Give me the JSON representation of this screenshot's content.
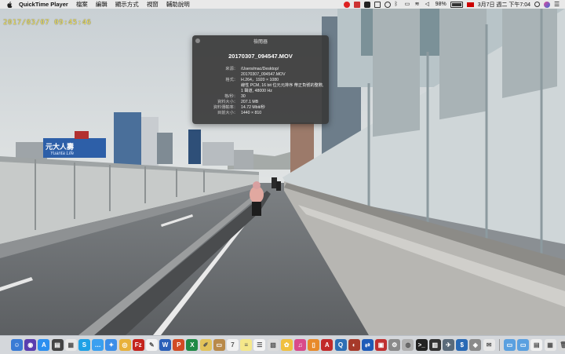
{
  "menubar": {
    "app_name": "QuickTime Player",
    "items": [
      "檔案",
      "編輯",
      "顯示方式",
      "視窗",
      "輔助說明"
    ],
    "battery_percent": "98%",
    "datetime": "3月7日 週二 下午7:04"
  },
  "video": {
    "timestamp": "2017/03/07  09:45:46",
    "billboard_text": "元大人壽",
    "billboard_sub": "Yuanta Life"
  },
  "inspector": {
    "title": "檢閱器",
    "filename": "20170307_094547.MOV",
    "rows": [
      {
        "key": "來源：",
        "value": "/Users/mac/Desktop/\n20170307_094547.MOV"
      },
      {
        "key": "格式：",
        "value": "H.264，1920 × 1080\n線性 PCM, 16 bit 位元元排序 帶正負號的整數, 1 聲道, 48000 Hz"
      },
      {
        "key": "格/秒：",
        "value": "30"
      },
      {
        "key": "資料大小：",
        "value": "207.1 MB"
      },
      {
        "key": "資料傳輸率：",
        "value": "14.72 Mbit/秒"
      },
      {
        "key": "目前大小：",
        "value": "1440 × 810"
      }
    ]
  },
  "dock": {
    "icons": [
      {
        "name": "finder-icon",
        "color": "#3a7bd5",
        "glyph": "☺"
      },
      {
        "name": "siri-icon",
        "color": "#5a3fb0",
        "glyph": "◉"
      },
      {
        "name": "app-store-icon",
        "color": "#2b8ff0",
        "glyph": "A"
      },
      {
        "name": "notes-dark-icon",
        "color": "#444",
        "glyph": "▤"
      },
      {
        "name": "calendar-icon",
        "color": "#e8e8e8",
        "glyph": "▦"
      },
      {
        "name": "skype-icon",
        "color": "#1ea1e6",
        "glyph": "S"
      },
      {
        "name": "messages-icon",
        "color": "#3aa0f0",
        "glyph": "…"
      },
      {
        "name": "safari-icon",
        "color": "#3c8ee8",
        "glyph": "✦"
      },
      {
        "name": "chrome-icon",
        "color": "#e8b13a",
        "glyph": "◎"
      },
      {
        "name": "filezilla-icon",
        "color": "#c4241c",
        "glyph": "Fz"
      },
      {
        "name": "textedit-icon",
        "color": "#f4f4f4",
        "glyph": "✎"
      },
      {
        "name": "word-icon",
        "color": "#2b5fb8",
        "glyph": "W"
      },
      {
        "name": "powerpoint-icon",
        "color": "#d14b24",
        "glyph": "P"
      },
      {
        "name": "excel-icon",
        "color": "#1f8a46",
        "glyph": "X"
      },
      {
        "name": "pencil-icon",
        "color": "#e3c35a",
        "glyph": "✐"
      },
      {
        "name": "folder-icon",
        "color": "#b98a4a",
        "glyph": "▭"
      },
      {
        "name": "calendar-7-icon",
        "color": "#f2f2f2",
        "glyph": "7"
      },
      {
        "name": "notes-icon",
        "color": "#f5e88a",
        "glyph": "≡"
      },
      {
        "name": "reminders-icon",
        "color": "#f4f4f4",
        "glyph": "☰"
      },
      {
        "name": "preview-icon",
        "color": "#dcdcdc",
        "glyph": "▧"
      },
      {
        "name": "photos-icon",
        "color": "#f0c040",
        "glyph": "✿"
      },
      {
        "name": "itunes-icon",
        "color": "#d94a8a",
        "glyph": "♫"
      },
      {
        "name": "ibooks-icon",
        "color": "#e88a2a",
        "glyph": "▯"
      },
      {
        "name": "acrobat-icon",
        "color": "#c22a2a",
        "glyph": "A"
      },
      {
        "name": "quicktime-icon",
        "color": "#2d6fb5",
        "glyph": "Q"
      },
      {
        "name": "photo-booth-icon",
        "color": "#a63a2a",
        "glyph": "◐"
      },
      {
        "name": "teamviewer-icon",
        "color": "#1e5bb8",
        "glyph": "⇄"
      },
      {
        "name": "photo-icon",
        "color": "#c03030",
        "glyph": "▣"
      },
      {
        "name": "system-prefs-icon",
        "color": "#8a8a8a",
        "glyph": "⚙"
      },
      {
        "name": "disk-utility-icon",
        "color": "#b0b0b0",
        "glyph": "◍"
      },
      {
        "name": "terminal-icon",
        "color": "#222",
        "glyph": ">_"
      },
      {
        "name": "activity-icon",
        "color": "#333",
        "glyph": "▥"
      },
      {
        "name": "launchpad-icon",
        "color": "#5a6a7a",
        "glyph": "✈"
      },
      {
        "name": "finance-icon",
        "color": "#2a6ab5",
        "glyph": "$"
      },
      {
        "name": "network-icon",
        "color": "#8a8a8a",
        "glyph": "◈"
      },
      {
        "name": "mail-icon",
        "color": "#e8e8e8",
        "glyph": "✉"
      }
    ],
    "right_icons": [
      {
        "name": "folder-downloads-icon",
        "color": "#5aa0e0",
        "glyph": "▭"
      },
      {
        "name": "folder-docs-icon",
        "color": "#5aa0e0",
        "glyph": "▭"
      },
      {
        "name": "screenshot-stack-icon",
        "color": "#f0f0f0",
        "glyph": "▤"
      },
      {
        "name": "document-stack-icon",
        "color": "#e8e8e8",
        "glyph": "▦"
      },
      {
        "name": "trash-icon",
        "color": "#d8d8d8",
        "glyph": "🗑"
      }
    ]
  }
}
